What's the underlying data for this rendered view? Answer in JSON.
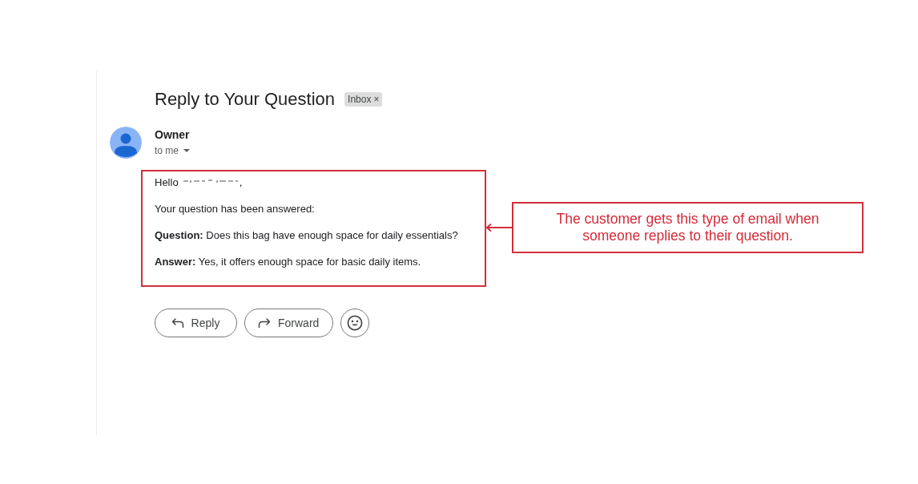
{
  "email": {
    "subject": "Reply to Your Question",
    "label": {
      "text": "Inbox",
      "remove": "×"
    }
  },
  "message": {
    "sender": "Owner",
    "recipient": "to me"
  },
  "body": {
    "greeting": "Hello",
    "name_redacted": true,
    "greeting_end": ",",
    "intro": "Your question has been answered:",
    "fields": [
      "**Question:** Does this bag have enough space for daily essentials?",
      "**Answer:** Yes, it offers enough space for basic daily items."
    ]
  },
  "actions": [
    {
      "kind": "reply",
      "label": "Reply"
    },
    {
      "kind": "forward",
      "label": "Forward"
    },
    {
      "kind": "emoji"
    }
  ],
  "annotation": {
    "text": "The customer gets this type of email when someone replies to their question."
  }
}
